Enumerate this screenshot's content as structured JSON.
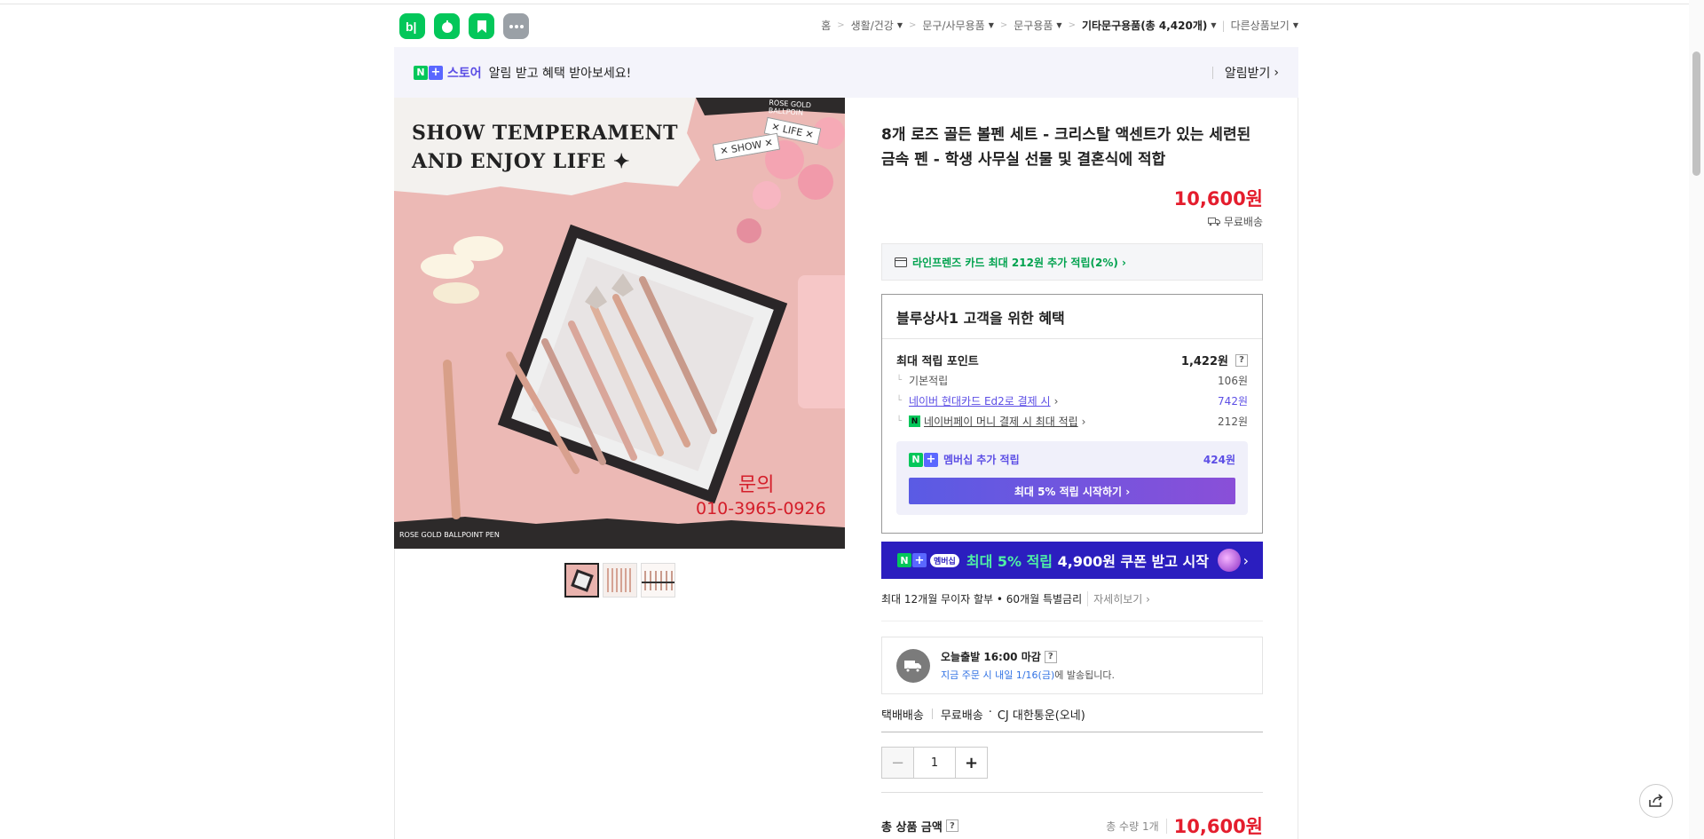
{
  "breadcrumb": {
    "home": "홈",
    "cat1": "생활/건강",
    "cat2": "문구/사무용품",
    "cat3": "문구용품",
    "cat4": "기타문구용품(총 4,420개)",
    "other": "다른상품보기"
  },
  "store_banner": {
    "store_word": "스토어",
    "message": "알림 받고 혜택 받아보세요!",
    "alarm": "알림받기"
  },
  "product_image": {
    "headline1": "SHOW TEMPERAMENT",
    "headline2": "AND ENJOY LIFE ✦",
    "tag_life": "✕ LIFE ✕",
    "tag_show": "✕ SHOW ✕",
    "top_strip": "ROSE GOLD BALLPOIN",
    "bottom_strip": "ROSE GOLD BALLPOINT PEN",
    "inquiry": "문의",
    "phone": "010-3965-0926"
  },
  "product": {
    "title": "8개 로즈 골든 볼펜 세트 - 크리스탈 액센트가 있는 세련된 금속 펜 - 학생 사무실 선물 및 결혼식에 적합",
    "price": "10,600원",
    "delivery": "무료배송"
  },
  "card_offer": "라인프렌즈 카드 최대 212원 추가 적립(2%) ›",
  "benefits": {
    "heading": "블루상사1 고객을 위한 혜택",
    "max_points_label": "최대 적립 포인트",
    "max_points_value": "1,422원",
    "basic_label": "기본적립",
    "basic_value": "106원",
    "card_label": "네이버 현대카드 Ed2로 결제 시",
    "card_value": "742원",
    "npay_label": "네이버페이 머니 결제 시 최대 적립",
    "npay_value": "212원",
    "membership_label": "멤버십 추가 적립",
    "membership_value": "424원",
    "membership_button": "최대 5% 적립 시작하기 ›"
  },
  "promo": {
    "tag": "멤버십",
    "text_hl": "최대 5% 적립",
    "text_rest": " 4,900원 쿠폰 받고 시작"
  },
  "installment": {
    "text": "최대 12개월 무이자 할부 • 60개월 특별금리",
    "more": "자세히보기 ›"
  },
  "shipping": {
    "title": "오늘출발 16:00 마감",
    "sub_blue": "지금 주문 시 내일 1/16(금)",
    "sub_rest": "에 발송됩니다.",
    "method": "택배배송",
    "fee": "무료배송",
    "carrier": "CJ 대한통운(오네)"
  },
  "quantity": {
    "value": "1"
  },
  "total": {
    "label": "총 상품 금액",
    "count": "총 수량 1개",
    "amount": "10,600원"
  },
  "icons": {
    "blog": "blog-icon",
    "apple": "apple-icon",
    "bookmark": "bookmark-icon",
    "more": "more-icon",
    "truck": "truck-icon",
    "share": "share-icon",
    "card": "card-icon"
  },
  "colors": {
    "naver_green": "#03c75a",
    "price_red": "#e41d2d",
    "purple": "#5c4ee5"
  }
}
